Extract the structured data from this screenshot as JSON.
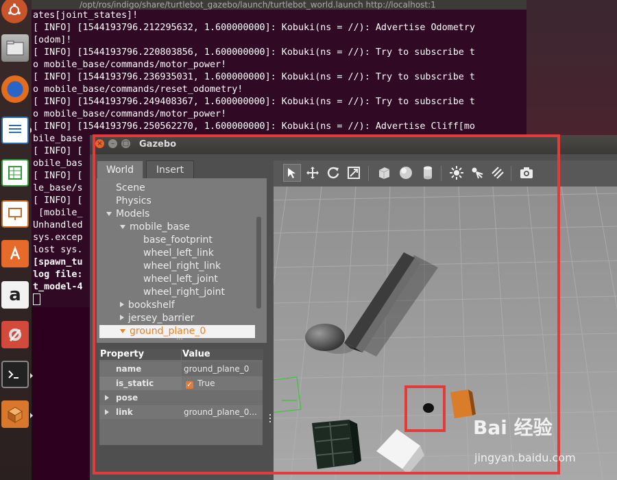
{
  "terminal": {
    "title": "/opt/ros/indigo/share/turtlebot_gazebo/launch/turtlebot_world.launch http://localhost:1",
    "lines": [
      {
        "text": "ates[joint_states]!",
        "bold": false
      },
      {
        "text": "[ INFO] [1544193796.212295632, 1.600000000]: Kobuki(ns = //): Advertise Odometry",
        "bold": false
      },
      {
        "text": "[odom]!",
        "bold": false
      },
      {
        "text": "[ INFO] [1544193796.220803856, 1.600000000]: Kobuki(ns = //): Try to subscribe t",
        "bold": false
      },
      {
        "text": "o mobile_base/commands/motor_power!",
        "bold": false
      },
      {
        "text": "[ INFO] [1544193796.236935031, 1.600000000]: Kobuki(ns = //): Try to subscribe t",
        "bold": false
      },
      {
        "text": "o mobile_base/commands/reset_odometry!",
        "bold": false
      },
      {
        "text": "[ INFO] [1544193796.249408367, 1.600000000]: Kobuki(ns = //): Try to subscribe t",
        "bold": false
      },
      {
        "text": "o mobile_base/commands/motor_power!",
        "bold": false
      },
      {
        "text": "[ INFO] [1544193796.250562270, 1.600000000]: Kobuki(ns = //): Advertise Cliff[mo",
        "bold": false
      },
      {
        "text": "bile_base",
        "bold": false
      },
      {
        "text": "[ INFO] [",
        "bold": false
      },
      {
        "text": "obile_bas",
        "bold": false
      },
      {
        "text": "[ INFO] [",
        "bold": false
      },
      {
        "text": "le_base/s",
        "bold": false
      },
      {
        "text": "[ INFO] [",
        "bold": false
      },
      {
        "text": " [mobile_",
        "bold": false
      },
      {
        "text": "Unhandled",
        "bold": false
      },
      {
        "text": "sys.excep",
        "bold": false
      },
      {
        "text": "lost sys.",
        "bold": false
      },
      {
        "text": "[spawn_tu",
        "bold": true
      },
      {
        "text": "log file:",
        "bold": true
      },
      {
        "text": "t_model-4",
        "bold": true
      }
    ]
  },
  "gazebo": {
    "title": "Gazebo",
    "tabs": {
      "world": "World",
      "insert": "Insert"
    },
    "tree": {
      "scene": "Scene",
      "physics": "Physics",
      "models": "Models",
      "mobile_base": "mobile_base",
      "mobile_base_children": [
        "base_footprint",
        "wheel_left_link",
        "wheel_right_link",
        "wheel_left_joint",
        "wheel_right_joint"
      ],
      "bookshelf": "bookshelf",
      "jersey_barrier": "jersey_barrier",
      "ground_plane": "ground_plane_0",
      "lights_partial": "..."
    },
    "properties": {
      "header_property": "Property",
      "header_value": "Value",
      "rows": {
        "name_label": "name",
        "name_value": "ground_plane_0",
        "static_label": "is_static",
        "static_value": "True",
        "pose_label": "pose",
        "link_label": "link",
        "link_value": "ground_plane_0..."
      }
    },
    "toolbar_icons": [
      "select-arrow-icon",
      "translate-icon",
      "rotate-icon",
      "scale-icon",
      "box-icon",
      "sphere-icon",
      "cylinder-icon",
      "point-light-icon",
      "spot-light-icon",
      "directional-light-icon",
      "screenshot-icon"
    ]
  },
  "watermark": {
    "logo": "Bai 经验",
    "url": "jingyan.baidu.com"
  },
  "colors": {
    "highlight": "#e43a3a",
    "selection_text": "#e8822a",
    "terminal_bg": "#300a24"
  }
}
